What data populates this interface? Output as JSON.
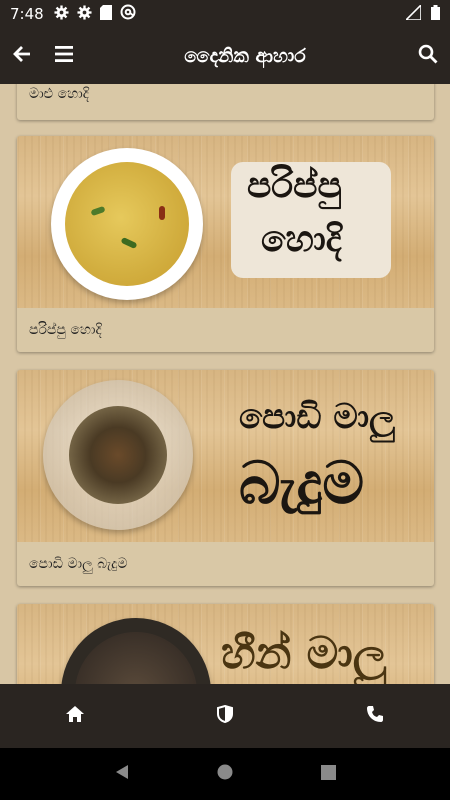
{
  "status_bar": {
    "time": "7:48",
    "icons": [
      "gear-icon",
      "gear-icon",
      "sd-card-icon",
      "at-sign-icon"
    ],
    "right_icons": [
      "signal-icon",
      "battery-icon"
    ]
  },
  "app_bar": {
    "title": "දෛනික ආහාර",
    "back_icon": "arrow-left-icon",
    "menu_icon": "hamburger-icon",
    "search_icon": "search-icon"
  },
  "recipes": [
    {
      "label": "මාළු හොදි",
      "image_text": []
    },
    {
      "label": "පරිප්පු හොදි",
      "image_text": [
        "පරිප්පු",
        "හොදි"
      ]
    },
    {
      "label": "පොඩි මාලු බැදුම",
      "image_text": [
        "පොඩි මාලු",
        "බැදුම"
      ]
    },
    {
      "label": "",
      "image_text": [
        "හීන් මාලු"
      ]
    }
  ],
  "bottom_nav": [
    {
      "icon": "home-icon"
    },
    {
      "icon": "shield-icon"
    },
    {
      "icon": "phone-icon"
    }
  ],
  "system_nav": [
    "back-triangle-icon",
    "home-circle-icon",
    "recents-square-icon"
  ],
  "colors": {
    "bar": "#2a2521",
    "background": "#d8c6a5",
    "card_label_bg": "#d9c8a6",
    "curry": "#d6b54a"
  }
}
